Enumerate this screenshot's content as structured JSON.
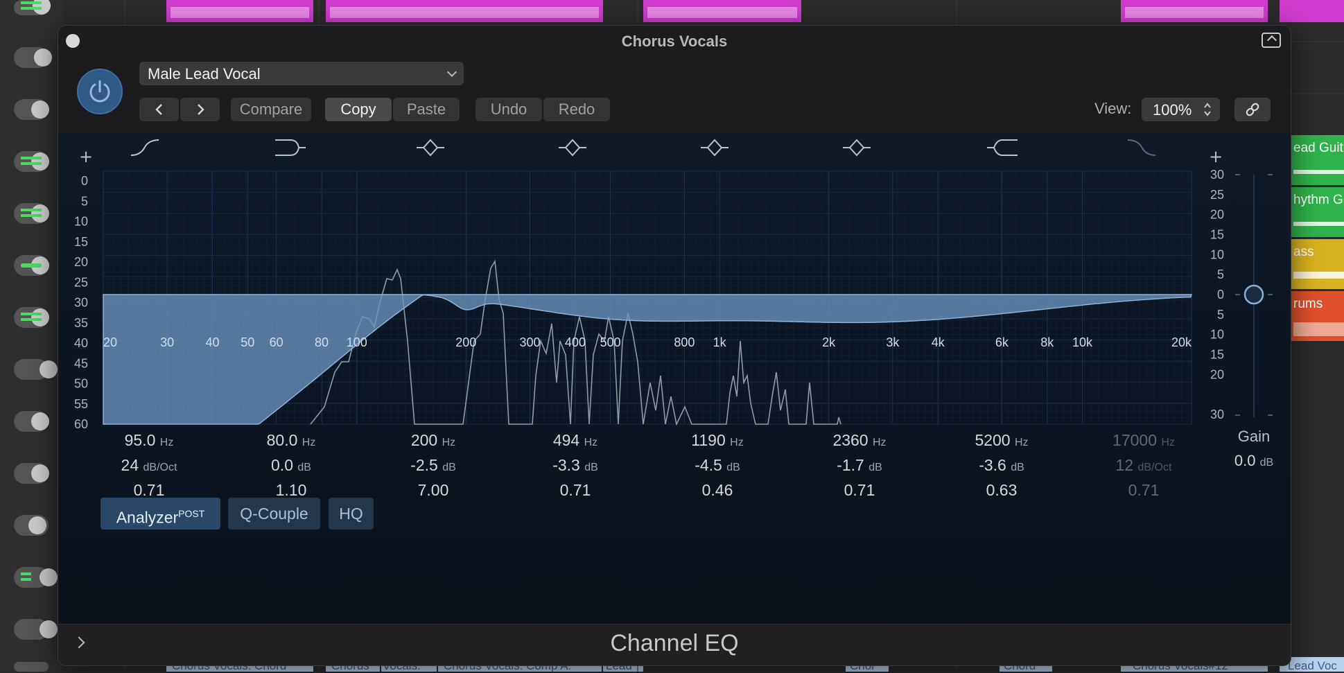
{
  "window": {
    "title": "Chorus Vocals",
    "footer_title": "Channel EQ"
  },
  "toolbar": {
    "preset": "Male Lead Vocal",
    "compare": "Compare",
    "copy": "Copy",
    "paste": "Paste",
    "undo": "Undo",
    "redo": "Redo",
    "view_label": "View:",
    "view_value": "100%"
  },
  "bands": [
    {
      "freq": "95.0",
      "freq_unit": "Hz",
      "gain": "24",
      "gain_unit": "dB/Oct",
      "q": "0.71",
      "active": true
    },
    {
      "freq": "80.0",
      "freq_unit": "Hz",
      "gain": "0.0",
      "gain_unit": "dB",
      "q": "1.10",
      "active": true
    },
    {
      "freq": "200",
      "freq_unit": "Hz",
      "gain": "-2.5",
      "gain_unit": "dB",
      "q": "7.00",
      "active": true
    },
    {
      "freq": "494",
      "freq_unit": "Hz",
      "gain": "-3.3",
      "gain_unit": "dB",
      "q": "0.71",
      "active": true
    },
    {
      "freq": "1190",
      "freq_unit": "Hz",
      "gain": "-4.5",
      "gain_unit": "dB",
      "q": "0.46",
      "active": true
    },
    {
      "freq": "2360",
      "freq_unit": "Hz",
      "gain": "-1.7",
      "gain_unit": "dB",
      "q": "0.71",
      "active": true
    },
    {
      "freq": "5200",
      "freq_unit": "Hz",
      "gain": "-3.6",
      "gain_unit": "dB",
      "q": "0.63",
      "active": true
    },
    {
      "freq": "17000",
      "freq_unit": "Hz",
      "gain": "12",
      "gain_unit": "dB/Oct",
      "q": "0.71",
      "active": false
    }
  ],
  "freq_labels": [
    "20",
    "30",
    "40",
    "50",
    "60",
    "80",
    "100",
    "200",
    "300",
    "400",
    "500",
    "800",
    "1k",
    "2k",
    "3k",
    "4k",
    "6k",
    "8k",
    "10k",
    "20k"
  ],
  "freq_values": [
    20,
    30,
    40,
    50,
    60,
    80,
    100,
    200,
    300,
    400,
    500,
    800,
    1000,
    2000,
    3000,
    4000,
    6000,
    8000,
    10000,
    20000
  ],
  "left_scale": [
    "0",
    "5",
    "10",
    "15",
    "20",
    "25",
    "30",
    "35",
    "40",
    "45",
    "50",
    "55",
    "60"
  ],
  "right_scale": [
    "30",
    "25",
    "20",
    "15",
    "10",
    "5",
    "0",
    "5",
    "10",
    "15",
    "20",
    "30"
  ],
  "output_gain": {
    "label": "Gain",
    "value": "0.0",
    "unit": "dB"
  },
  "toggles": {
    "analyzer": "Analyzer",
    "analyzer_badge": "POST",
    "qcouple": "Q-Couple",
    "hq": "HQ"
  },
  "tracks": {
    "right_labels": [
      "ead Guit",
      "hythm G",
      "ass",
      "rums"
    ],
    "bottom_labels": [
      "Chorus Vocals: Chord",
      "Chorus",
      "Vocals:",
      "Chorus Vocals: Comp A:",
      "Lead",
      "Chor",
      "Chord",
      "Chorus Vocals#12",
      "Lead Voc"
    ]
  },
  "colors": {
    "accent_blue": "#2f5a88",
    "region_magenta": "#d23cd0",
    "track_green": "#2fb34a",
    "track_yellow": "#d8b21f",
    "track_orange": "#e0502a",
    "curve_fill": "#6c93bf"
  }
}
